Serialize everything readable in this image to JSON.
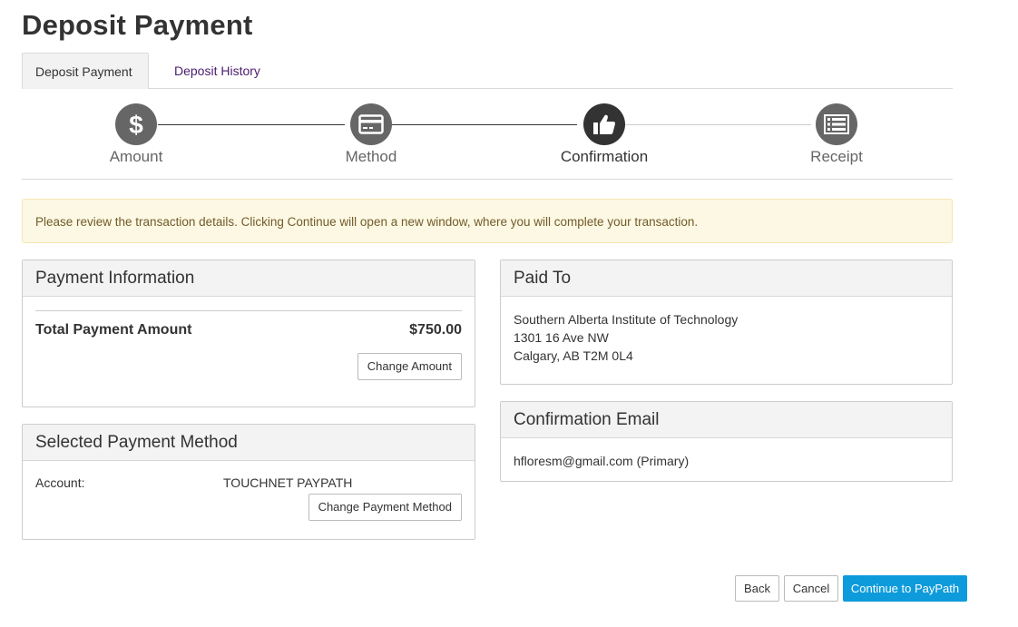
{
  "page": {
    "title": "Deposit Payment"
  },
  "tabs": [
    {
      "label": "Deposit Payment",
      "active": true
    },
    {
      "label": "Deposit History",
      "active": false
    }
  ],
  "steps": [
    {
      "label": "Amount",
      "icon": "dollar-icon"
    },
    {
      "label": "Method",
      "icon": "credit-card-icon"
    },
    {
      "label": "Confirmation",
      "icon": "thumbs-up-icon",
      "current": true
    },
    {
      "label": "Receipt",
      "icon": "list-icon"
    }
  ],
  "alert": {
    "text": "Please review the transaction details. Clicking Continue will open a new window, where you will complete your transaction."
  },
  "payment_info": {
    "title": "Payment Information",
    "total_label": "Total Payment Amount",
    "total_value": "$750.00",
    "change_button": "Change Amount"
  },
  "payment_method": {
    "title": "Selected Payment Method",
    "account_label": "Account:",
    "account_value": "TOUCHNET PAYPATH",
    "change_button": "Change Payment Method"
  },
  "paid_to": {
    "title": "Paid To",
    "lines": [
      "Southern Alberta Institute of Technology",
      "1301 16 Ave NW",
      "Calgary, AB T2M 0L4"
    ]
  },
  "confirmation_email": {
    "title": "Confirmation Email",
    "email": "hfloresm@gmail.com (Primary)"
  },
  "footer": {
    "back": "Back",
    "cancel": "Cancel",
    "continue": "Continue to PayPath"
  },
  "colors": {
    "accent": "#0e9bdb",
    "tab_link": "#4b1c6f",
    "alert_bg": "#fcf8e3",
    "step_active": "#333333",
    "step_inactive": "#666666"
  }
}
